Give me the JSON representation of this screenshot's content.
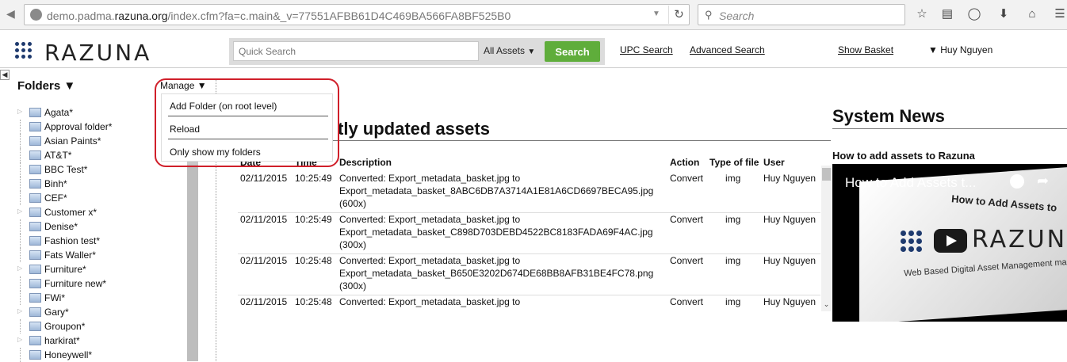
{
  "browser": {
    "url_prefix": "demo.padma.",
    "url_domain": "razuna.org",
    "url_suffix": "/index.cfm?fa=c.main&_v=77551AFBB61D4C469BA566FA8BF525B0",
    "search_placeholder": "Search"
  },
  "header": {
    "logo_text": "RAZUNA",
    "quick_search_placeholder": "Quick Search",
    "scope_select": "All Assets",
    "search_button": "Search",
    "links": [
      "UPC Search",
      "Advanced Search",
      "Show Basket"
    ],
    "user_name": "Huy Nguyen"
  },
  "sidebar": {
    "title": "Folders",
    "folders": [
      "Agata*",
      "Approval folder*",
      "Asian Paints*",
      "AT&T*",
      "BBC Test*",
      "Binh*",
      "CEF*",
      "Customer x*",
      "Denise*",
      "Fashion test*",
      "Fats Waller*",
      "Furniture*",
      "Furniture new*",
      "FWi*",
      "Gary*",
      "Groupon*",
      "harkirat*",
      "Honeywell*"
    ]
  },
  "manage_menu": {
    "label": "Manage",
    "items": [
      "Add Folder (on root level)",
      "Reload",
      "Only show my folders"
    ]
  },
  "main": {
    "title": "tly updated assets",
    "columns": [
      "Date",
      "Time",
      "Description",
      "Action",
      "Type of file",
      "User"
    ],
    "rows": [
      {
        "date": "02/11/2015",
        "time": "10:25:49",
        "desc1": "Converted: Export_metadata_basket.jpg to",
        "desc2": "Export_metadata_basket_8ABC6DB7A3714A1E81A6CD6697BECA95.jpg",
        "desc3": "(600x)",
        "action": "Convert",
        "type": "img",
        "user": "Huy Nguyen"
      },
      {
        "date": "02/11/2015",
        "time": "10:25:49",
        "desc1": "Converted: Export_metadata_basket.jpg to",
        "desc2": "Export_metadata_basket_C898D703DEBD4522BC8183FADA69F4AC.jpg",
        "desc3": "(300x)",
        "action": "Convert",
        "type": "img",
        "user": "Huy Nguyen"
      },
      {
        "date": "02/11/2015",
        "time": "10:25:48",
        "desc1": "Converted: Export_metadata_basket.jpg to",
        "desc2": "Export_metadata_basket_B650E3202D674DE68BB8AFB31BE4FC78.png",
        "desc3": "(300x)",
        "action": "Convert",
        "type": "img",
        "user": "Huy Nguyen"
      },
      {
        "date": "02/11/2015",
        "time": "10:25:48",
        "desc1": "Converted: Export_metadata_basket.jpg to",
        "desc2": "",
        "desc3": "",
        "action": "Convert",
        "type": "img",
        "user": "Huy Nguyen"
      }
    ]
  },
  "news": {
    "title": "System News",
    "item_title": "How to add assets to Razuna",
    "video_title": "How to Add Assets t...",
    "video_heading": "How to Add Assets to",
    "video_logo": "RAZUNA",
    "video_tagline": "Web Based Digital Asset Management made Easy"
  }
}
